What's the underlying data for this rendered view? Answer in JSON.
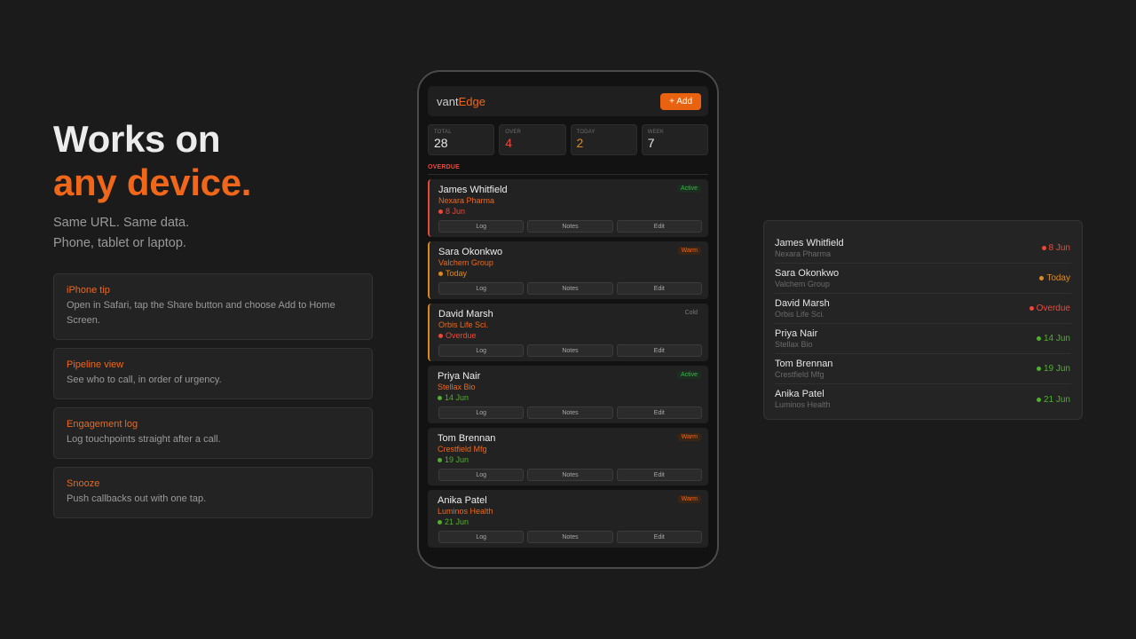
{
  "hero": {
    "title_line1": "Works on",
    "title_line2": "any device.",
    "sub_line1": "Same URL. Same data.",
    "sub_line2": "Phone, tablet or laptop."
  },
  "features": [
    {
      "title": "iPhone tip",
      "desc": "Open in Safari, tap the Share button and choose Add to Home Screen."
    },
    {
      "title": "Pipeline view",
      "desc": "See who to call, in order of urgency."
    },
    {
      "title": "Engagement log",
      "desc": "Log touchpoints straight after a call."
    },
    {
      "title": "Snooze",
      "desc": "Push callbacks out with one tap."
    }
  ],
  "app": {
    "brand_a": "vant",
    "brand_b": "Edge",
    "add_label": "+ Add",
    "stats": [
      {
        "label": "TOTAL",
        "value": "28",
        "color": "#e8e8e8"
      },
      {
        "label": "OVER",
        "value": "4",
        "color": "#e84a3a"
      },
      {
        "label": "TODAY",
        "value": "2",
        "color": "#e08a1e"
      },
      {
        "label": "WEEK",
        "value": "7",
        "color": "#e8e8e8"
      }
    ],
    "section_label": "OVERDUE",
    "action_labels": {
      "log": "Log",
      "notes": "Notes",
      "edit": "Edit"
    },
    "cards": [
      {
        "name": "James Whitfield",
        "company": "Nexara Pharma",
        "date": "8 Jun",
        "status": "Active",
        "date_color": "#e84a3a",
        "border": "red"
      },
      {
        "name": "Sara Okonkwo",
        "company": "Valchem Group",
        "date": "Today",
        "status": "Warm",
        "date_color": "#e08a1e",
        "border": "amber"
      },
      {
        "name": "David Marsh",
        "company": "Orbis Life Sci.",
        "date": "Overdue",
        "status": "Cold",
        "date_color": "#e84a3a",
        "border": "amber"
      },
      {
        "name": "Priya Nair",
        "company": "Stellax Bio",
        "date": "14 Jun",
        "status": "Active",
        "date_color": "#4fb02c",
        "border": "none"
      },
      {
        "name": "Tom Brennan",
        "company": "Crestfield Mfg",
        "date": "19 Jun",
        "status": "Warm",
        "date_color": "#4fb02c",
        "border": "none"
      },
      {
        "name": "Anika Patel",
        "company": "Luminos Health",
        "date": "21 Jun",
        "status": "Warm",
        "date_color": "#4fb02c",
        "border": "none"
      }
    ]
  },
  "panel": {
    "rows": [
      {
        "name": "James Whitfield",
        "company": "Nexara Pharma",
        "date": "8 Jun",
        "color": "#e84a3a"
      },
      {
        "name": "Sara Okonkwo",
        "company": "Valchem Group",
        "date": "Today",
        "color": "#e08a1e"
      },
      {
        "name": "David Marsh",
        "company": "Orbis Life Sci.",
        "date": "Overdue",
        "color": "#e84a3a"
      },
      {
        "name": "Priya Nair",
        "company": "Stellax Bio",
        "date": "14 Jun",
        "color": "#4fb02c"
      },
      {
        "name": "Tom Brennan",
        "company": "Crestfield Mfg",
        "date": "19 Jun",
        "color": "#4fb02c"
      },
      {
        "name": "Anika Patel",
        "company": "Luminos Health",
        "date": "21 Jun",
        "color": "#4fb02c"
      }
    ]
  }
}
